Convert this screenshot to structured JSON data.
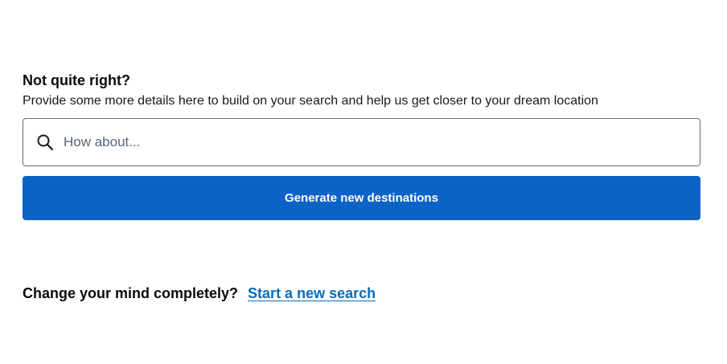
{
  "refine": {
    "heading": "Not quite right?",
    "subtext": "Provide some more details here to build on your search and help us get closer to your dream location",
    "search": {
      "placeholder": "How about...",
      "value": "",
      "icon": "search-icon"
    },
    "generate_label": "Generate new destinations"
  },
  "restart": {
    "label": "Change your mind completely?",
    "link_text": "Start a new search"
  },
  "colors": {
    "primary_button": "#0b63c8",
    "link": "#0a6bb8",
    "text": "#0b0b0b",
    "placeholder": "#56657a",
    "border": "#6b6b6b"
  }
}
